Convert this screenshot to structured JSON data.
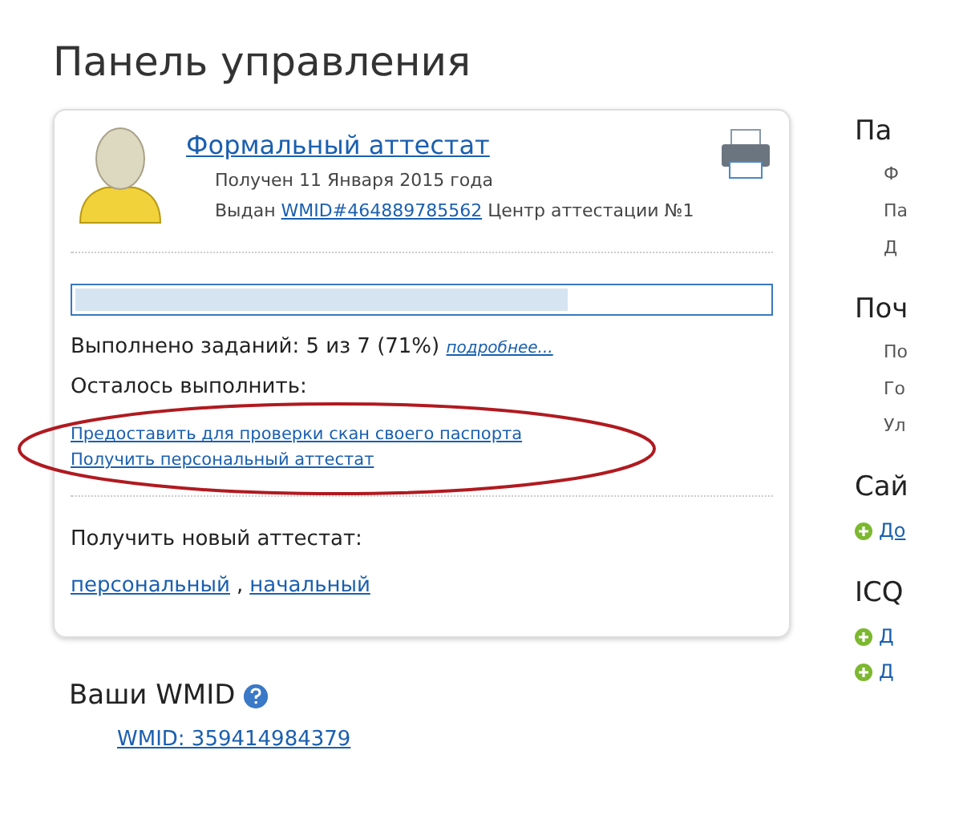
{
  "page_title": "Панель управления",
  "certificate": {
    "title": "Формальный аттестат",
    "received": "Получен 11 Января 2015 года",
    "issued_label": "Выдан",
    "issuer_wmid": "WMID#464889785562",
    "center": "Центр аттестации №1",
    "progress": {
      "level": 0.71
    },
    "tasks_done": "Выполнено заданий: 5 из 7 (71%)",
    "details_link": "подробнее...",
    "remaining_label": "Осталось выполнить:",
    "remaining_tasks": [
      "Предоставить для проверки скан своего паспорта",
      "Получить персональный аттестат"
    ],
    "new_label": "Получить новый аттестат:",
    "new_links": [
      "персональный",
      "начальный"
    ],
    "separator": ","
  },
  "wmid_section": {
    "title": "Ваши WMID",
    "wmid": "WMID: 359414984379"
  },
  "sidebar": [
    {
      "title": "Па",
      "items": [
        {
          "text": "Ф",
          "kind": "text"
        },
        {
          "text": "Па",
          "kind": "text"
        },
        {
          "text": "Д",
          "kind": "text"
        }
      ]
    },
    {
      "title": "Поч",
      "items": [
        {
          "text": "По",
          "kind": "text"
        },
        {
          "text": "Го",
          "kind": "text"
        },
        {
          "text": "Ул",
          "kind": "text"
        }
      ]
    },
    {
      "title": "Сай",
      "items": [
        {
          "text": "До",
          "kind": "add"
        }
      ]
    },
    {
      "title": "ICQ",
      "items": [
        {
          "text": "Д",
          "kind": "add"
        },
        {
          "text": "Д",
          "kind": "add"
        }
      ]
    }
  ]
}
